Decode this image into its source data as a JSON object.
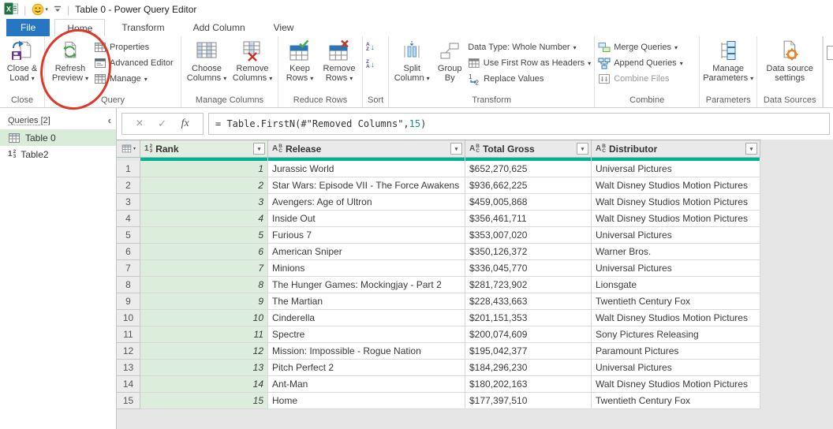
{
  "title_bar": {
    "title": "Table 0 - Power Query Editor"
  },
  "tabs": [
    "File",
    "Home",
    "Transform",
    "Add Column",
    "View"
  ],
  "ribbon": {
    "close_load": "Close & Load",
    "close_group": "Close",
    "refresh_preview": "Refresh Preview",
    "properties": "Properties",
    "advanced_editor": "Advanced Editor",
    "manage": "Manage",
    "query_group": "Query",
    "choose_columns": "Choose Columns",
    "remove_columns": "Remove Columns",
    "manage_columns_group": "Manage Columns",
    "keep_rows": "Keep Rows",
    "remove_rows": "Remove Rows",
    "reduce_rows_group": "Reduce Rows",
    "sort_group": "Sort",
    "split_column": "Split Column",
    "group_by": "Group By",
    "data_type": "Data Type: Whole Number",
    "use_first_row": "Use First Row as Headers",
    "replace_values": "Replace Values",
    "transform_group": "Transform",
    "merge_queries": "Merge Queries",
    "append_queries": "Append Queries",
    "combine_files": "Combine Files",
    "combine_group": "Combine",
    "manage_parameters": "Manage Parameters",
    "parameters_group": "Parameters",
    "data_source_settings": "Data source settings",
    "data_sources_group": "Data Sources"
  },
  "queries_pane": {
    "header": "Queries [2]",
    "items": [
      {
        "label": "Table 0",
        "selected": true
      },
      {
        "label": "Table2",
        "badge_main": "1",
        "badge_sup": "2",
        "badge_sub": "3"
      }
    ]
  },
  "formula_bar": {
    "fx": "fx",
    "formula_main": "= Table.FirstN(#\"Removed Columns\",",
    "formula_arg": "15",
    "formula_close": ")"
  },
  "grid": {
    "columns": [
      {
        "label": "Rank",
        "badge_main": "1",
        "badge_sup": "2",
        "badge_sub": "3"
      },
      {
        "label": "Release",
        "badge_main": "A",
        "badge_sup": "B",
        "badge_sub": "C"
      },
      {
        "label": "Total Gross",
        "badge_main": "A",
        "badge_sup": "B",
        "badge_sub": "C"
      },
      {
        "label": "Distributor",
        "badge_main": "A",
        "badge_sup": "B",
        "badge_sub": "C"
      }
    ],
    "rows": [
      {
        "num": "1",
        "rank": "1",
        "release": "Jurassic World",
        "gross": "$652,270,625",
        "distributor": "Universal Pictures"
      },
      {
        "num": "2",
        "rank": "2",
        "release": "Star Wars: Episode VII - The Force Awakens",
        "gross": "$936,662,225",
        "distributor": "Walt Disney Studios Motion Pictures"
      },
      {
        "num": "3",
        "rank": "3",
        "release": "Avengers: Age of Ultron",
        "gross": "$459,005,868",
        "distributor": "Walt Disney Studios Motion Pictures"
      },
      {
        "num": "4",
        "rank": "4",
        "release": "Inside Out",
        "gross": "$356,461,711",
        "distributor": "Walt Disney Studios Motion Pictures"
      },
      {
        "num": "5",
        "rank": "5",
        "release": "Furious 7",
        "gross": "$353,007,020",
        "distributor": "Universal Pictures"
      },
      {
        "num": "6",
        "rank": "6",
        "release": "American Sniper",
        "gross": "$350,126,372",
        "distributor": "Warner Bros."
      },
      {
        "num": "7",
        "rank": "7",
        "release": "Minions",
        "gross": "$336,045,770",
        "distributor": "Universal Pictures"
      },
      {
        "num": "8",
        "rank": "8",
        "release": "The Hunger Games: Mockingjay - Part 2",
        "gross": "$281,723,902",
        "distributor": "Lionsgate"
      },
      {
        "num": "9",
        "rank": "9",
        "release": "The Martian",
        "gross": "$228,433,663",
        "distributor": "Twentieth Century Fox"
      },
      {
        "num": "10",
        "rank": "10",
        "release": "Cinderella",
        "gross": "$201,151,353",
        "distributor": "Walt Disney Studios Motion Pictures"
      },
      {
        "num": "11",
        "rank": "11",
        "release": "Spectre",
        "gross": "$200,074,609",
        "distributor": "Sony Pictures Releasing"
      },
      {
        "num": "12",
        "rank": "12",
        "release": "Mission: Impossible - Rogue Nation",
        "gross": "$195,042,377",
        "distributor": "Paramount Pictures"
      },
      {
        "num": "13",
        "rank": "13",
        "release": "Pitch Perfect 2",
        "gross": "$184,296,230",
        "distributor": "Universal Pictures"
      },
      {
        "num": "14",
        "rank": "14",
        "release": "Ant-Man",
        "gross": "$180,202,163",
        "distributor": "Walt Disney Studios Motion Pictures"
      },
      {
        "num": "15",
        "rank": "15",
        "release": "Home",
        "gross": "$177,397,510",
        "distributor": "Twentieth Century Fox"
      }
    ]
  },
  "icons": {
    "dropdown_caret": "▾",
    "sort_arrow_down": "↓",
    "sort_a": "A",
    "sort_z": "Z",
    "cancel": "×",
    "check": "✓",
    "collapse_chevron": "‹",
    "excel_x": "X",
    "replace_one": "1",
    "replace_two": "2"
  },
  "colors": {
    "accent_teal": "#00B294",
    "selection_green": "#DCEDDC",
    "file_tab_blue": "#2776C1",
    "annotation_red": "#DD3927"
  }
}
